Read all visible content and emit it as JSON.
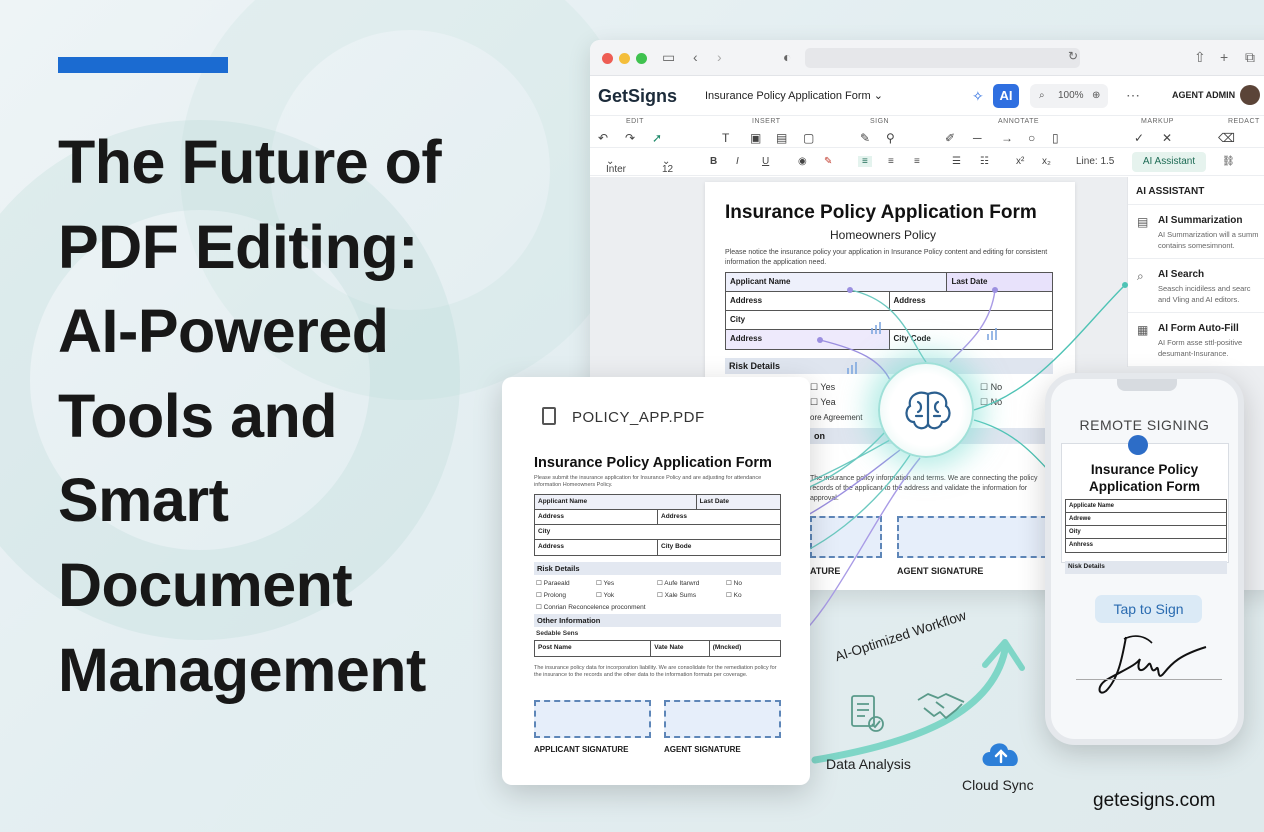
{
  "headline": {
    "lines": [
      "The Future of",
      "PDF Editing:",
      "AI-Powered",
      "Tools and",
      "Smart",
      "Document",
      "Management"
    ]
  },
  "app": {
    "logo": "GetSigns",
    "doc_title": "Insurance Policy Application Form",
    "ai_label": "AI",
    "zoom": "100%",
    "user": "AGENT ADMIN",
    "groups": [
      "EDIT",
      "INSERT",
      "SIGN",
      "ANNOTATE",
      "MARKUP",
      "REDACT"
    ],
    "font": "Inter",
    "font_size": "12",
    "line_spacing": "Line: 1.5",
    "ai_assistant_button": "AI Assistant"
  },
  "page": {
    "title": "Insurance Policy Application Form",
    "subtitle": "Homeowners Policy",
    "blurb": "Please notice the insurance policy your application in Insurance Policy content and editing for consistent information the application need.",
    "fields": [
      [
        "Applicant Name",
        "Last Date"
      ],
      [
        "Address",
        "Address"
      ],
      [
        "City",
        ""
      ],
      [
        "Address",
        "City Code"
      ]
    ],
    "risk": "Risk Details",
    "options": [
      "Yes",
      "Yea",
      "No",
      "No"
    ],
    "note": "ore Agreement",
    "section": "on",
    "paragraph": "The insurance policy information and terms. We are connecting the policy records of the applicant to the address and validate the information for approval.",
    "sig_right": "AGENT SIGNATURE",
    "sig_left": "ATURE"
  },
  "ai_panel": {
    "heading": "AI ASSISTANT",
    "items": [
      {
        "title": "AI Summarization",
        "desc": [
          "AI Summarization will a summ",
          "contains somesimnont."
        ]
      },
      {
        "title": "AI Search",
        "desc": [
          "Seasch incidiless and searc",
          "and Vling and AI editors."
        ]
      },
      {
        "title": "AI Form Auto-Fill",
        "desc": [
          "AI Form asse sttl-positive",
          "desumant-Insurance."
        ]
      }
    ]
  },
  "float_doc": {
    "file": "POLICY_APP.PDF",
    "title": "Insurance Policy Application Form",
    "blurb": "Please submit the insurance application for Insurance Policy and are adjusting for attendance information Homeowners Policy.",
    "fields": [
      [
        "Applicant Name",
        "Last Date"
      ],
      [
        "Address",
        "Address"
      ],
      [
        "City",
        ""
      ],
      [
        "Address",
        "City Bode"
      ]
    ],
    "risk": "Risk Details",
    "checks": [
      "Paraeald",
      "Yes",
      "Aufe Itarwrd",
      "No",
      "Prolong",
      "Yok",
      "Xale Sums",
      "Ko",
      "Conrian Reconcelence proconment"
    ],
    "other": "Other Information",
    "other_sub": "Sedable Sens",
    "last_row": [
      "Post Name",
      "Vate Nate",
      "(Mncked)"
    ],
    "paragraph": "The insurance policy data for incorporation liability. We are consolidate for the remediation policy for the insurance to the records and the other data to the information formats per coverage.",
    "sig_left": "APPLICANT SIGNATURE",
    "sig_right": "AGENT SIGNATURE"
  },
  "phone": {
    "heading": "REMOTE SIGNING",
    "title": "Insurance Policy Application Form",
    "rows": [
      "Applicate Name",
      "Adrewe",
      "Oity",
      "Anhress"
    ],
    "section": "Nisk Details",
    "button": "Tap to Sign"
  },
  "flow": {
    "workflow": "AI-Optimized Workflow",
    "analysis": "Data Analysis",
    "cloud": "Cloud Sync"
  },
  "site": "getesigns.com",
  "colors": {
    "accent": "#1b6bd1",
    "teal": "#4fc3b5",
    "purple": "#9b8fe0"
  }
}
